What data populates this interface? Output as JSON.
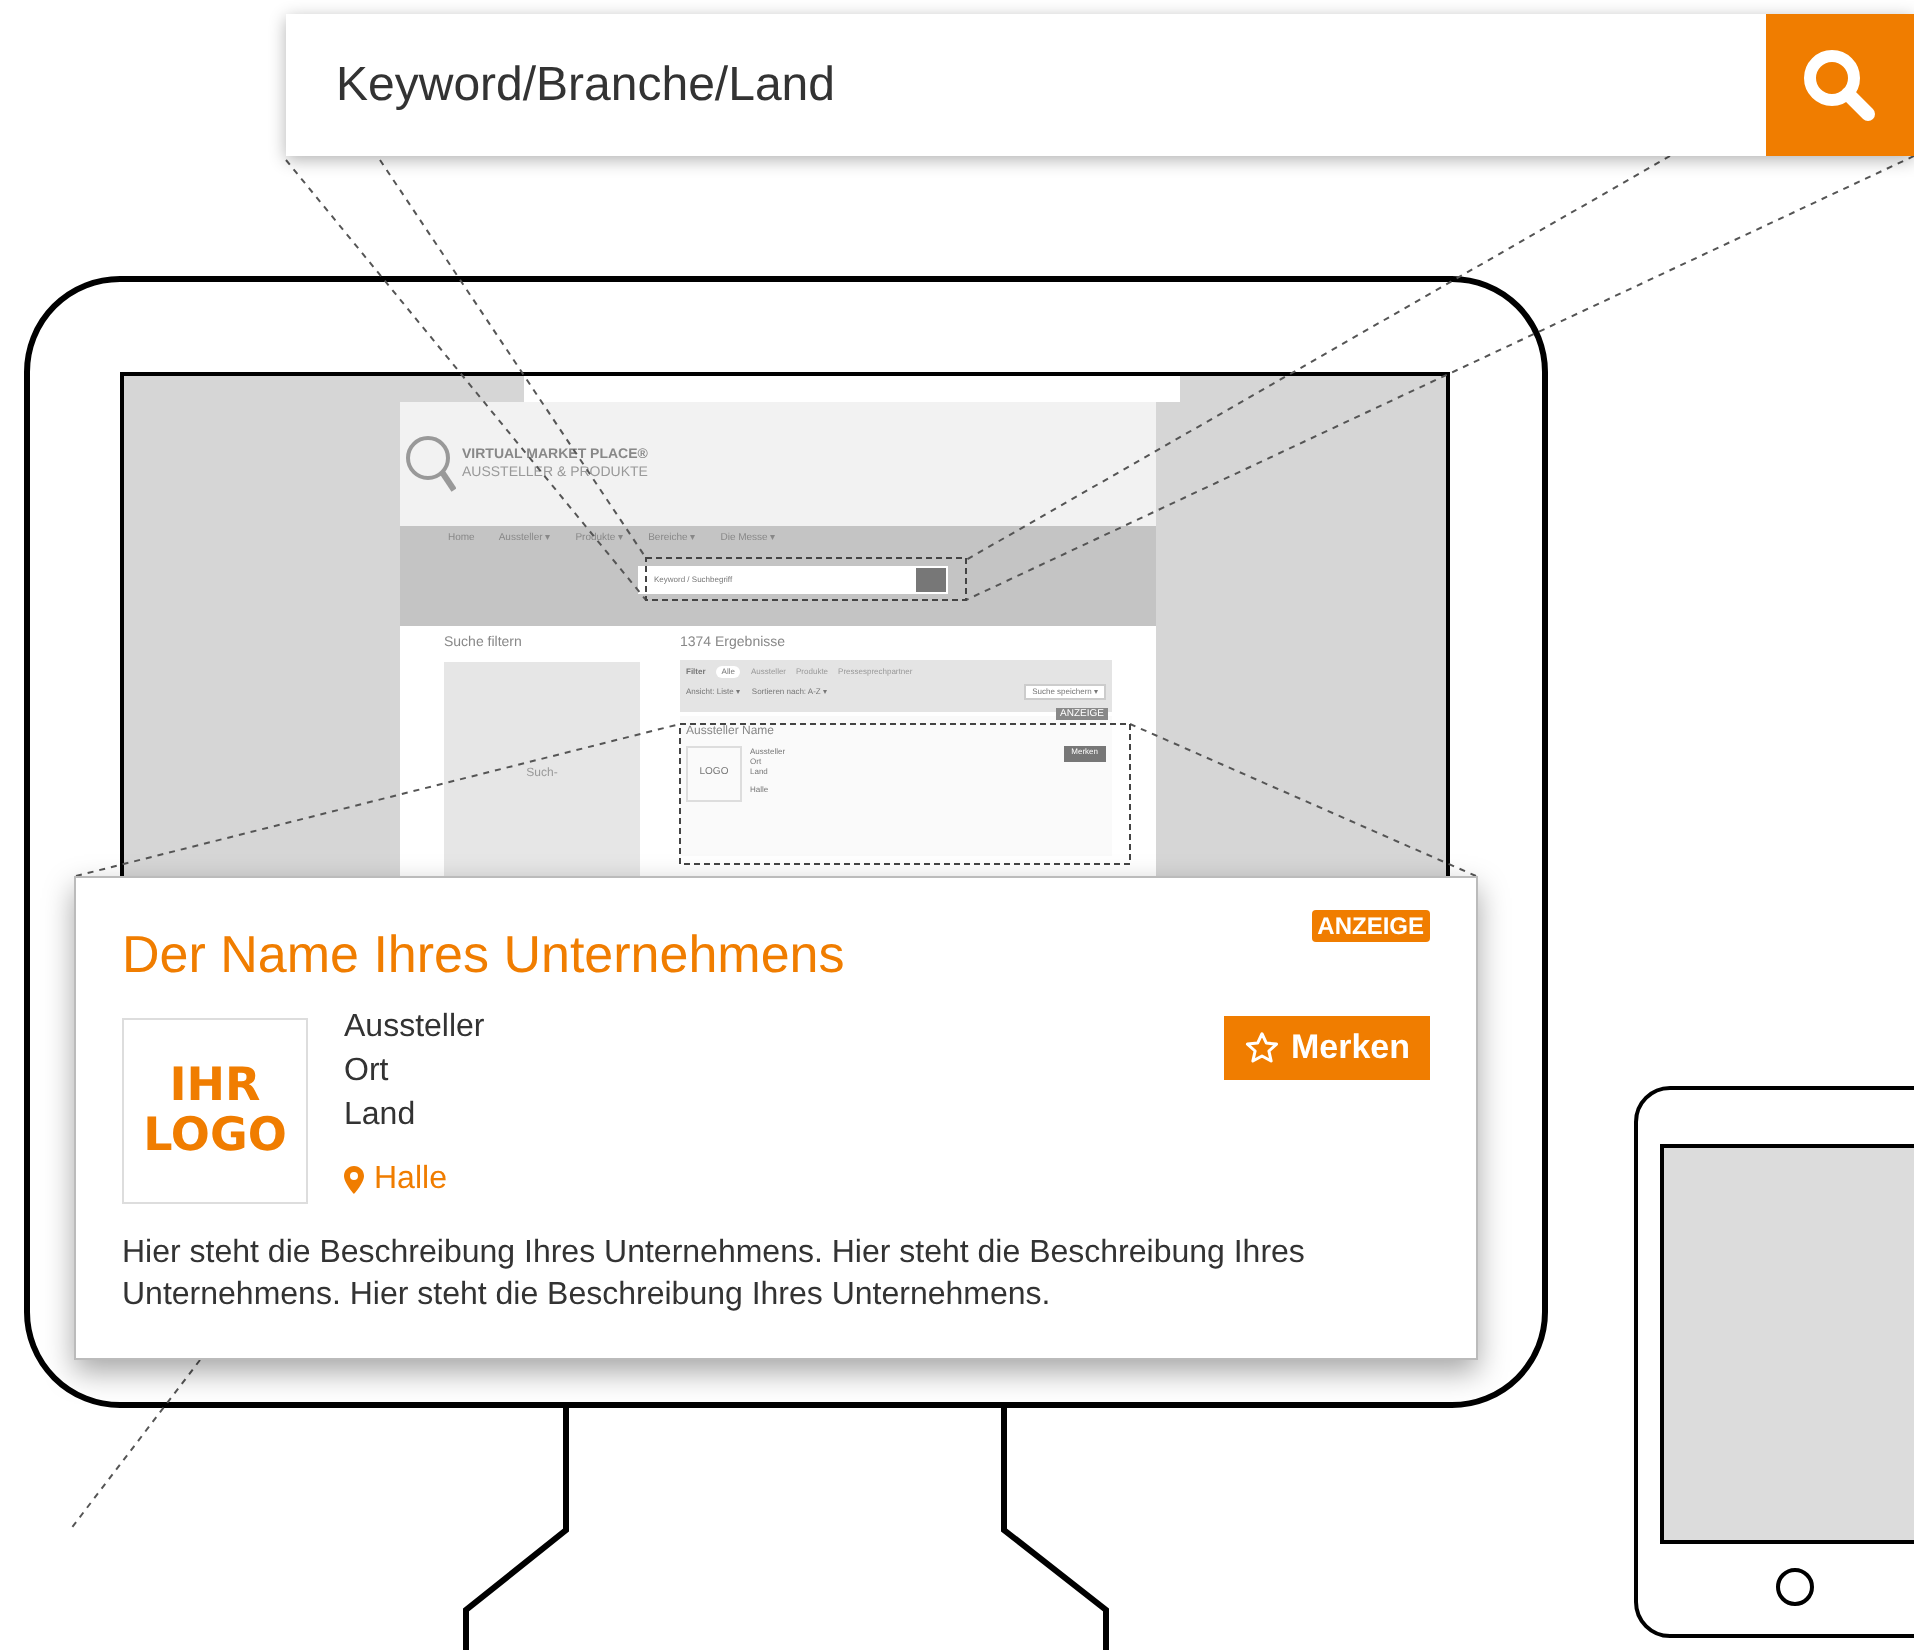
{
  "search_bar": {
    "placeholder": "Keyword/Branche/Land"
  },
  "website": {
    "logo_title": "VIRTUAL MARKET PLACE®",
    "logo_subtitle": "AUSSTELLER & PRODUKTE",
    "nav": [
      {
        "label": "Home"
      },
      {
        "label": "Aussteller ▾"
      },
      {
        "label": "Produkte ▾"
      },
      {
        "label": "Bereiche ▾"
      },
      {
        "label": "Die Messe ▾"
      }
    ],
    "search_placeholder": "Keyword / Suchbegriff",
    "filter_title": "Suche filtern",
    "filter_panel_label": "Such-",
    "results": "1374 Ergebnisse",
    "filter_label": "Filter",
    "filter_tabs": [
      {
        "label": "Alle",
        "selected": true
      },
      {
        "label": "Aussteller",
        "selected": false
      },
      {
        "label": "Produkte",
        "selected": false
      },
      {
        "label": "Pressesprechpartner",
        "selected": false
      }
    ],
    "view": "Ansicht: Liste ▾",
    "sort": "Sortieren nach: A-Z ▾",
    "save": "Suche speichern ▾",
    "preview_card": {
      "badge": "ANZEIGE",
      "name": "Aussteller Name",
      "logo": "LOGO",
      "details": [
        "Aussteller",
        "Ort",
        "Land"
      ],
      "hall": "Halle",
      "button": "Merken"
    }
  },
  "card": {
    "badge": "ANZEIGE",
    "title": "Der Name Ihres Unternehmens",
    "logo": [
      "IHR",
      "LOGO"
    ],
    "details": [
      "Aussteller",
      "Ort",
      "Land"
    ],
    "hall": "Halle",
    "button": "Merken",
    "description": "Hier steht die Beschreibung Ihres Unternehmens. Hier steht die Beschreibung Ihres Unternehmens. Hier steht die Beschreibung Ihres Unternehmens."
  }
}
